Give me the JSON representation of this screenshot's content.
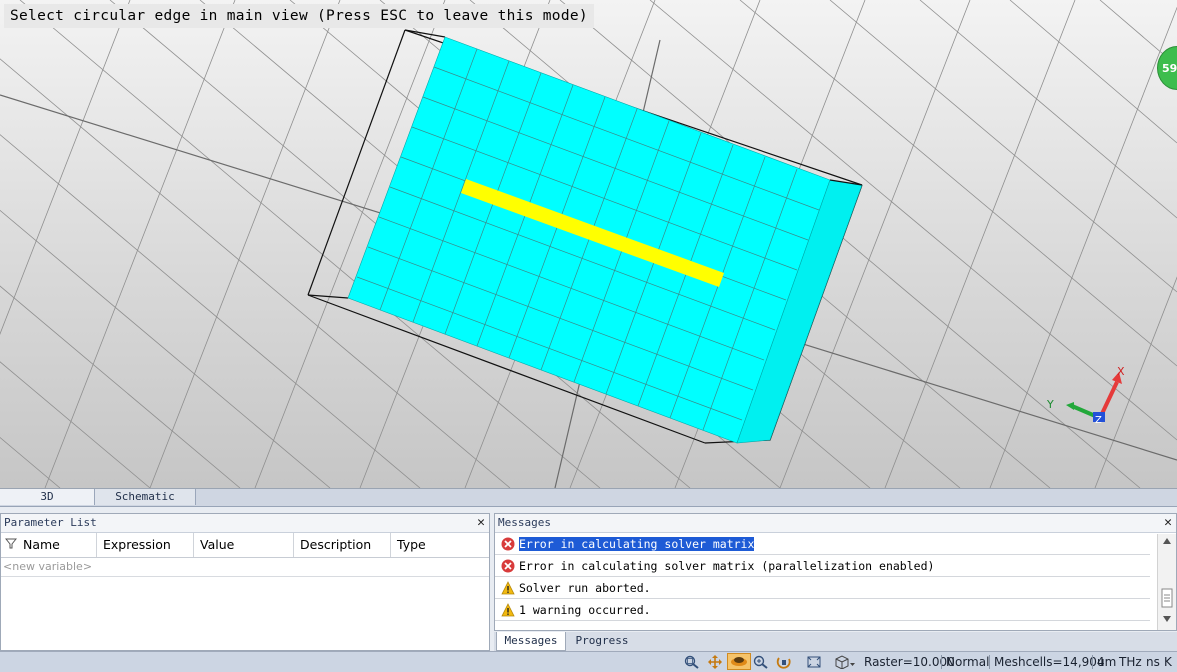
{
  "viewport": {
    "mode_banner": "Select circular edge in main view (Press ESC to leave this mode)",
    "badge_text": "59",
    "axes": {
      "x": "X",
      "y": "Y",
      "z": "Z"
    },
    "colors": {
      "substrate": "#00ffff",
      "strip": "#ffff00",
      "axis_x": "#e53a3a",
      "axis_y": "#22a83a",
      "axis_z": "#2250d8"
    }
  },
  "view_tabs": [
    {
      "label": "3D"
    },
    {
      "label": "Schematic"
    }
  ],
  "parameter_list": {
    "title": "Parameter List",
    "columns": [
      "Name",
      "Expression",
      "Value",
      "Description",
      "Type"
    ],
    "new_variable_placeholder": "<new variable>"
  },
  "messages": {
    "title": "Messages",
    "rows": [
      {
        "type": "error-icon",
        "text": "Error in calculating solver matrix",
        "selected": true
      },
      {
        "type": "error-icon",
        "text": "Error in calculating solver matrix (parallelization enabled)"
      },
      {
        "type": "warning-icon",
        "text": "Solver run aborted."
      },
      {
        "type": "warning-icon",
        "text": "1 warning occurred."
      }
    ],
    "tabs": [
      "Messages",
      "Progress"
    ]
  },
  "status_bar": {
    "raster": "Raster=10.000",
    "mode": "Normal",
    "meshcells": "Meshcells=14,904",
    "units": [
      "um",
      "THz",
      "ns",
      "K"
    ]
  }
}
